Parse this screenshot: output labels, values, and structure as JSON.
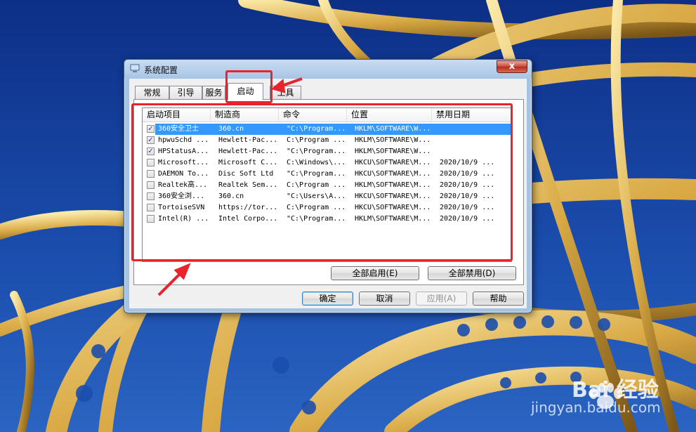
{
  "window": {
    "title": "系统配置",
    "close_label": "x"
  },
  "tabs": [
    {
      "label": "常规",
      "active": false
    },
    {
      "label": "引导",
      "active": false
    },
    {
      "label": "服务",
      "active": false
    },
    {
      "label": "启动",
      "active": true
    },
    {
      "label": "工具",
      "active": false
    }
  ],
  "startup_list": {
    "columns": [
      "启动项目",
      "制造商",
      "命令",
      "位置",
      "禁用日期"
    ],
    "rows": [
      {
        "checked": true,
        "selected": true,
        "item": "360安全卫士",
        "maker": "360.cn",
        "command": "\"C:\\Program...",
        "location": "HKLM\\SOFTWARE\\W...",
        "disabled_date": ""
      },
      {
        "checked": true,
        "selected": false,
        "item": "hpwuSchd ...",
        "maker": "Hewlett-Pac...",
        "command": "C:\\Program ...",
        "location": "HKLM\\SOFTWARE\\W...",
        "disabled_date": ""
      },
      {
        "checked": true,
        "selected": false,
        "item": "HPStatusA...",
        "maker": "Hewlett-Pac...",
        "command": "\"C:\\Program...",
        "location": "HKLM\\SOFTWARE\\W...",
        "disabled_date": ""
      },
      {
        "checked": false,
        "selected": false,
        "item": "Microsoft...",
        "maker": "Microsoft C...",
        "command": "C:\\Windows\\...",
        "location": "HKCU\\SOFTWARE\\M...",
        "disabled_date": "2020/10/9 ..."
      },
      {
        "checked": false,
        "selected": false,
        "item": "DAEMON To...",
        "maker": "Disc Soft Ltd",
        "command": "\"C:\\Program...",
        "location": "HKCU\\SOFTWARE\\M...",
        "disabled_date": "2020/10/9 ..."
      },
      {
        "checked": false,
        "selected": false,
        "item": "Realtek高...",
        "maker": "Realtek Sem...",
        "command": "C:\\Program ...",
        "location": "HKLM\\SOFTWARE\\M...",
        "disabled_date": "2020/10/9 ..."
      },
      {
        "checked": false,
        "selected": false,
        "item": "360安全浏...",
        "maker": "360.cn",
        "command": "\"C:\\Users\\A...",
        "location": "HKCU\\SOFTWARE\\M...",
        "disabled_date": "2020/10/9 ..."
      },
      {
        "checked": false,
        "selected": false,
        "item": "TortoiseSVN",
        "maker": "https://tor...",
        "command": "C:\\Program ...",
        "location": "HKCU\\SOFTWARE\\M...",
        "disabled_date": "2020/10/9 ..."
      },
      {
        "checked": false,
        "selected": false,
        "item": "Intel(R) ...",
        "maker": "Intel Corpo...",
        "command": "\"C:\\Program...",
        "location": "HKLM\\SOFTWARE\\M...",
        "disabled_date": "2020/10/9 ..."
      }
    ]
  },
  "buttons": {
    "enable_all": "全部启用(E)",
    "disable_all": "全部禁用(D)",
    "ok": "确定",
    "cancel": "取消",
    "apply": "应用(A)",
    "help": "帮助"
  },
  "watermark": {
    "brand": "Bai 经验",
    "url": "jingyan.baidu.com"
  },
  "colors": {
    "annotation": "#e8232c",
    "selection": "#3399ff",
    "sky": "#1a3f8f"
  }
}
